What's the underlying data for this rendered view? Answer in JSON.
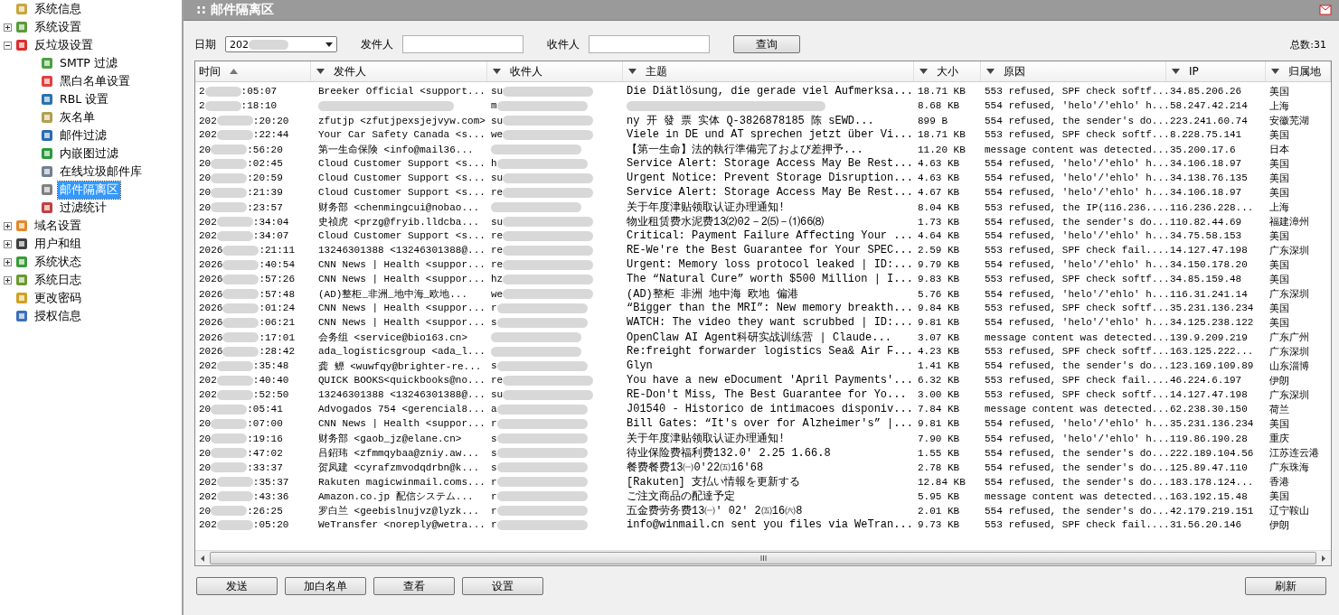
{
  "sidebar": {
    "items": [
      {
        "label": "系统信息"
      },
      {
        "label": "系统设置",
        "expanded": false
      },
      {
        "label": "反垃圾设置",
        "expanded": true,
        "children": [
          {
            "label": "SMTP 过滤",
            "selected": false
          },
          {
            "label": "黑白名单设置",
            "selected": false
          },
          {
            "label": "RBL 设置",
            "selected": false
          },
          {
            "label": "灰名单",
            "selected": false
          },
          {
            "label": "邮件过滤",
            "selected": false
          },
          {
            "label": "内嵌图过滤",
            "selected": false
          },
          {
            "label": "在线垃圾邮件库",
            "selected": false
          },
          {
            "label": "邮件隔离区",
            "selected": true
          },
          {
            "label": "过滤统计",
            "selected": false
          }
        ]
      },
      {
        "label": "域名设置",
        "expanded": false
      },
      {
        "label": "用户和组",
        "expanded": false
      },
      {
        "label": "系统状态",
        "expanded": false
      },
      {
        "label": "系统日志",
        "expanded": false
      },
      {
        "label": "更改密码"
      },
      {
        "label": "授权信息"
      }
    ]
  },
  "panel": {
    "title": ":: 邮件隔离区"
  },
  "filter": {
    "date_label": "日期",
    "date_value": "202",
    "sender_label": "发件人",
    "recipient_label": "收件人",
    "query_button": "查询",
    "total": "总数:31"
  },
  "table": {
    "columns": [
      {
        "label": "时间",
        "sorted": true
      },
      {
        "label": "发件人",
        "sorted": false
      },
      {
        "label": "收件人",
        "sorted": false
      },
      {
        "label": "主题",
        "sorted": false
      },
      {
        "label": "大小",
        "sorted": false
      },
      {
        "label": "原因",
        "sorted": false
      },
      {
        "label": "IP",
        "sorted": false
      },
      {
        "label": "归属地",
        "sorted": false
      }
    ],
    "rows": [
      {
        "time_head": "2",
        "time_tail": ":05:07",
        "sender": "Breeker Official <support...",
        "recipient": "su",
        "subject": "Die Diätlösung, die gerade viel Aufmerksa...",
        "size": "18.71 KB",
        "reason": "553 refused, SPF check softf...",
        "ip": "34.85.206.26",
        "location": "美国"
      },
      {
        "time_head": "2",
        "time_tail": ":18:10",
        "recipient": "m",
        "size": "8.68 KB",
        "reason": "554 refused, 'helo'/'ehlo' h...",
        "ip": "58.247.42.214",
        "location": "上海"
      },
      {
        "time_head": "202",
        "time_tail": ":20:20",
        "sender": "zfutjp <zfutjpexsjejvyw.com>",
        "recipient": "su",
        "subject": "ny 开 發 票 实体 Q-3826878185 陈  sEWD...",
        "size": "899 B",
        "reason": "554 refused, the sender's do...",
        "ip": "223.241.60.74",
        "location": "安徽芜湖"
      },
      {
        "time_head": "202",
        "time_tail": ":22:44",
        "sender": "Your Car Safety Canada <s...",
        "recipient": "we",
        "subject": "Viele in DE und AT sprechen jetzt über Vi...",
        "size": "18.71 KB",
        "reason": "553 refused, SPF check softf...",
        "ip": "8.228.75.141",
        "location": "美国"
      },
      {
        "time_head": "20",
        "time_tail": ":56:20",
        "sender": "第一生命保険 <info@mail36...",
        "subject": "【第一生命】法的執行準備完了および差押予...",
        "size": "11.20 KB",
        "reason": "message content was detected...",
        "ip": "35.200.17.6",
        "location": "日本"
      },
      {
        "time_head": "20",
        "time_tail": ":02:45",
        "sender": "Cloud Customer Support <s...",
        "recipient": "h",
        "subject": "Service Alert: Storage Access May Be Rest...",
        "size": "4.63 KB",
        "reason": "554 refused, 'helo'/'ehlo' h...",
        "ip": "34.106.18.97",
        "location": "美国"
      },
      {
        "time_head": "20",
        "time_tail": ":20:59",
        "sender": "Cloud Customer Support <s...",
        "recipient": "su",
        "subject": "Urgent Notice: Prevent Storage Disruption...",
        "size": "4.63 KB",
        "reason": "554 refused, 'helo'/'ehlo' h...",
        "ip": "34.138.76.135",
        "location": "美国"
      },
      {
        "time_head": "20",
        "time_tail": ":21:39",
        "sender": "Cloud Customer Support <s...",
        "recipient": "re",
        "subject": "Service Alert: Storage Access May Be Rest...",
        "size": "4.67 KB",
        "reason": "554 refused, 'helo'/'ehlo' h...",
        "ip": "34.106.18.97",
        "location": "美国"
      },
      {
        "time_head": "20",
        "time_tail": ":23:57",
        "sender": "财务部 <chenmingcui@nobao...",
        "subject": "关于年度津贴领取认证办理通知!",
        "size": "8.04 KB",
        "reason": "553 refused, the IP(116.236....",
        "ip": "116.236.228...",
        "location": "上海"
      },
      {
        "time_head": "202",
        "time_tail": ":34:04",
        "sender": "史祯虎 <przg@fryib.lldcba...",
        "recipient": "su",
        "subject": "物业租赁费水泥费13⑵02－2⑸－⑴66⑻",
        "size": "1.73 KB",
        "reason": "554 refused, the sender's do...",
        "ip": "110.82.44.69",
        "location": "福建漳州"
      },
      {
        "time_head": "202",
        "time_tail": ":34:07",
        "sender": "Cloud Customer Support <s...",
        "recipient": "re",
        "subject": "Critical: Payment Failure Affecting Your ...",
        "size": "4.64 KB",
        "reason": "554 refused, 'helo'/'ehlo' h...",
        "ip": "34.75.58.153",
        "location": "美国"
      },
      {
        "time_head": "2026",
        "time_tail": ":21:11",
        "sender": "13246301388 <13246301388@...",
        "recipient": "re",
        "subject": "RE-We're the Best Guarantee for Your SPEC...",
        "size": "2.59 KB",
        "reason": "553 refused, SPF check fail....",
        "ip": "14.127.47.198",
        "location": "广东深圳"
      },
      {
        "time_head": "2026",
        "time_tail": ":40:54",
        "sender": "CNN News | Health <suppor...",
        "recipient": "re",
        "subject": "Urgent: Memory loss protocol leaked | ID:...",
        "size": "9.79 KB",
        "reason": "554 refused, 'helo'/'ehlo' h...",
        "ip": "34.150.178.20",
        "location": "美国"
      },
      {
        "time_head": "2026",
        "time_tail": ":57:26",
        "sender": "CNN News | Health <suppor...",
        "recipient": "hz",
        "subject": "The “Natural Cure” worth $500 Million | I...",
        "size": "9.83 KB",
        "reason": "553 refused, SPF check softf...",
        "ip": "34.85.159.48",
        "location": "美国"
      },
      {
        "time_head": "2026",
        "time_tail": ":57:48",
        "sender": "(AD)整柜_非洲_地中海_欧地...",
        "recipient": "we",
        "subject": "(AD)整柜 非洲 地中海 欧地 偏港",
        "size": "5.76 KB",
        "reason": "554 refused, 'helo'/'ehlo' h...",
        "ip": "116.31.241.14",
        "location": "广东深圳"
      },
      {
        "time_head": "2026",
        "time_tail": ":01:24",
        "sender": "CNN News | Health <suppor...",
        "recipient": "r",
        "subject": "“Bigger than the MRI”: New memory breakth...",
        "size": "9.84 KB",
        "reason": "553 refused, SPF check softf...",
        "ip": "35.231.136.234",
        "location": "美国"
      },
      {
        "time_head": "2026",
        "time_tail": ":06:21",
        "sender": "CNN News | Health <suppor...",
        "recipient": "s",
        "subject": "WATCH: The video they want scrubbed | ID:...",
        "size": "9.81 KB",
        "reason": "554 refused, 'helo'/'ehlo' h...",
        "ip": "34.125.238.122",
        "location": "美国"
      },
      {
        "time_head": "2026",
        "time_tail": ":17:01",
        "sender": "会务组 <service@bio163.cn>",
        "subject": "OpenClaw AI Agent科研实战训练营 | Claude...",
        "size": "3.07 KB",
        "reason": "message content was detected...",
        "ip": "139.9.209.219",
        "location": "广东广州"
      },
      {
        "time_head": "2026",
        "time_tail": ":28:42",
        "sender": "ada_logisticsgroup <ada_l...",
        "subject": "Re:freight forwarder logistics Sea& Air F...",
        "size": "4.23 KB",
        "reason": "553 refused, SPF check softf...",
        "ip": "163.125.222...",
        "location": "广东深圳"
      },
      {
        "time_head": "202",
        "time_tail": ":35:48",
        "sender": "龚 鳔 <wuwfqy@brighter-re...",
        "recipient": "s",
        "subject": "Glyn",
        "size": "1.41 KB",
        "reason": "554 refused, the sender's do...",
        "ip": "123.169.109.89",
        "location": "山东淄博"
      },
      {
        "time_head": "202",
        "time_tail": ":40:40",
        "sender": "QUICK BOOKS<quickbooks@no...",
        "recipient": "re",
        "subject": "You have a new eDocument 'April Payments'...",
        "size": "6.32 KB",
        "reason": "553 refused, SPF check fail....",
        "ip": "46.224.6.197",
        "location": "伊朗"
      },
      {
        "time_head": "202",
        "time_tail": ":52:50",
        "sender": "13246301388 <13246301388@...",
        "recipient": "su",
        "subject": "RE-Don't Miss, The Best Guarantee for Yo...",
        "size": "3.00 KB",
        "reason": "553 refused, SPF check softf...",
        "ip": "14.127.47.198",
        "location": "广东深圳"
      },
      {
        "time_head": "20",
        "time_tail": ":05:41",
        "sender": "Advogados 754 <gerencial8...",
        "recipient": "a",
        "subject": "J01540 - Historico de intimacoes disponiv...",
        "size": "7.84 KB",
        "reason": "message content was detected...",
        "ip": "62.238.30.150",
        "location": "荷兰"
      },
      {
        "time_head": "20",
        "time_tail": ":07:00",
        "sender": "CNN News | Health <suppor...",
        "recipient": "r",
        "subject": "Bill Gates: “It's over for Alzheimer's” |...",
        "size": "9.81 KB",
        "reason": "554 refused, 'helo'/'ehlo' h...",
        "ip": "35.231.136.234",
        "location": "美国"
      },
      {
        "time_head": "20",
        "time_tail": ":19:16",
        "sender": "财务部 <gaob_jz@elane.cn>",
        "recipient": "s",
        "subject": "关于年度津贴领取认证办理通知!",
        "size": "7.90 KB",
        "reason": "554 refused, 'helo'/'ehlo' h...",
        "ip": "119.86.190.28",
        "location": "重庆"
      },
      {
        "time_head": "20",
        "time_tail": ":47:02",
        "sender": "吕鉊玮 <zfmmqybaa@zniy.aw...",
        "recipient": "s",
        "subject": "待业保险费福利费132.0' 2.25 1.66.8",
        "size": "1.55 KB",
        "reason": "554 refused, the sender's do...",
        "ip": "222.189.104.56",
        "location": "江苏连云港"
      },
      {
        "time_head": "20",
        "time_tail": ":33:37",
        "sender": "贺凤建 <cyrafzmvodqdrbn@k...",
        "recipient": "s",
        "subject": "餐费餐费13㈠0'22㈤16'68",
        "size": "2.78 KB",
        "reason": "554 refused, the sender's do...",
        "ip": "125.89.47.110",
        "location": "广东珠海"
      },
      {
        "time_head": "202",
        "time_tail": ":35:37",
        "sender": "Rakuten magicwinmail.coms...",
        "recipient": "r",
        "subject": "[Rakuten] 支払い情報を更新する",
        "size": "12.84 KB",
        "reason": "554 refused, the sender's do...",
        "ip": "183.178.124...",
        "location": "香港"
      },
      {
        "time_head": "202",
        "time_tail": ":43:36",
        "sender": "Amazon.co.jp 配信システム...",
        "recipient": "r",
        "subject": "ご注文商品の配達予定",
        "size": "5.95 KB",
        "reason": "message content was detected...",
        "ip": "163.192.15.48",
        "location": "美国"
      },
      {
        "time_head": "20",
        "time_tail": ":26:25",
        "sender": "罗白兰 <geebislnujvz@lyzk...",
        "recipient": "r",
        "subject": "五金费劳务费13㈠' 02' 2㈤16㈥8",
        "size": "2.01 KB",
        "reason": "554 refused, the sender's do...",
        "ip": "42.179.219.151",
        "location": "辽宁鞍山"
      },
      {
        "time_head": "202",
        "time_tail": ":05:20",
        "sender": "WeTransfer <noreply@wetra...",
        "recipient": "r",
        "subject": "info@winmail.cn sent you files via WeTran...",
        "size": "9.73 KB",
        "reason": "553 refused, SPF check fail....",
        "ip": "31.56.20.146",
        "location": "伊朗"
      }
    ]
  },
  "buttons_left": [
    "发送",
    "加白名单",
    "查看",
    "设置"
  ],
  "buttons_right": [
    "刷新"
  ]
}
